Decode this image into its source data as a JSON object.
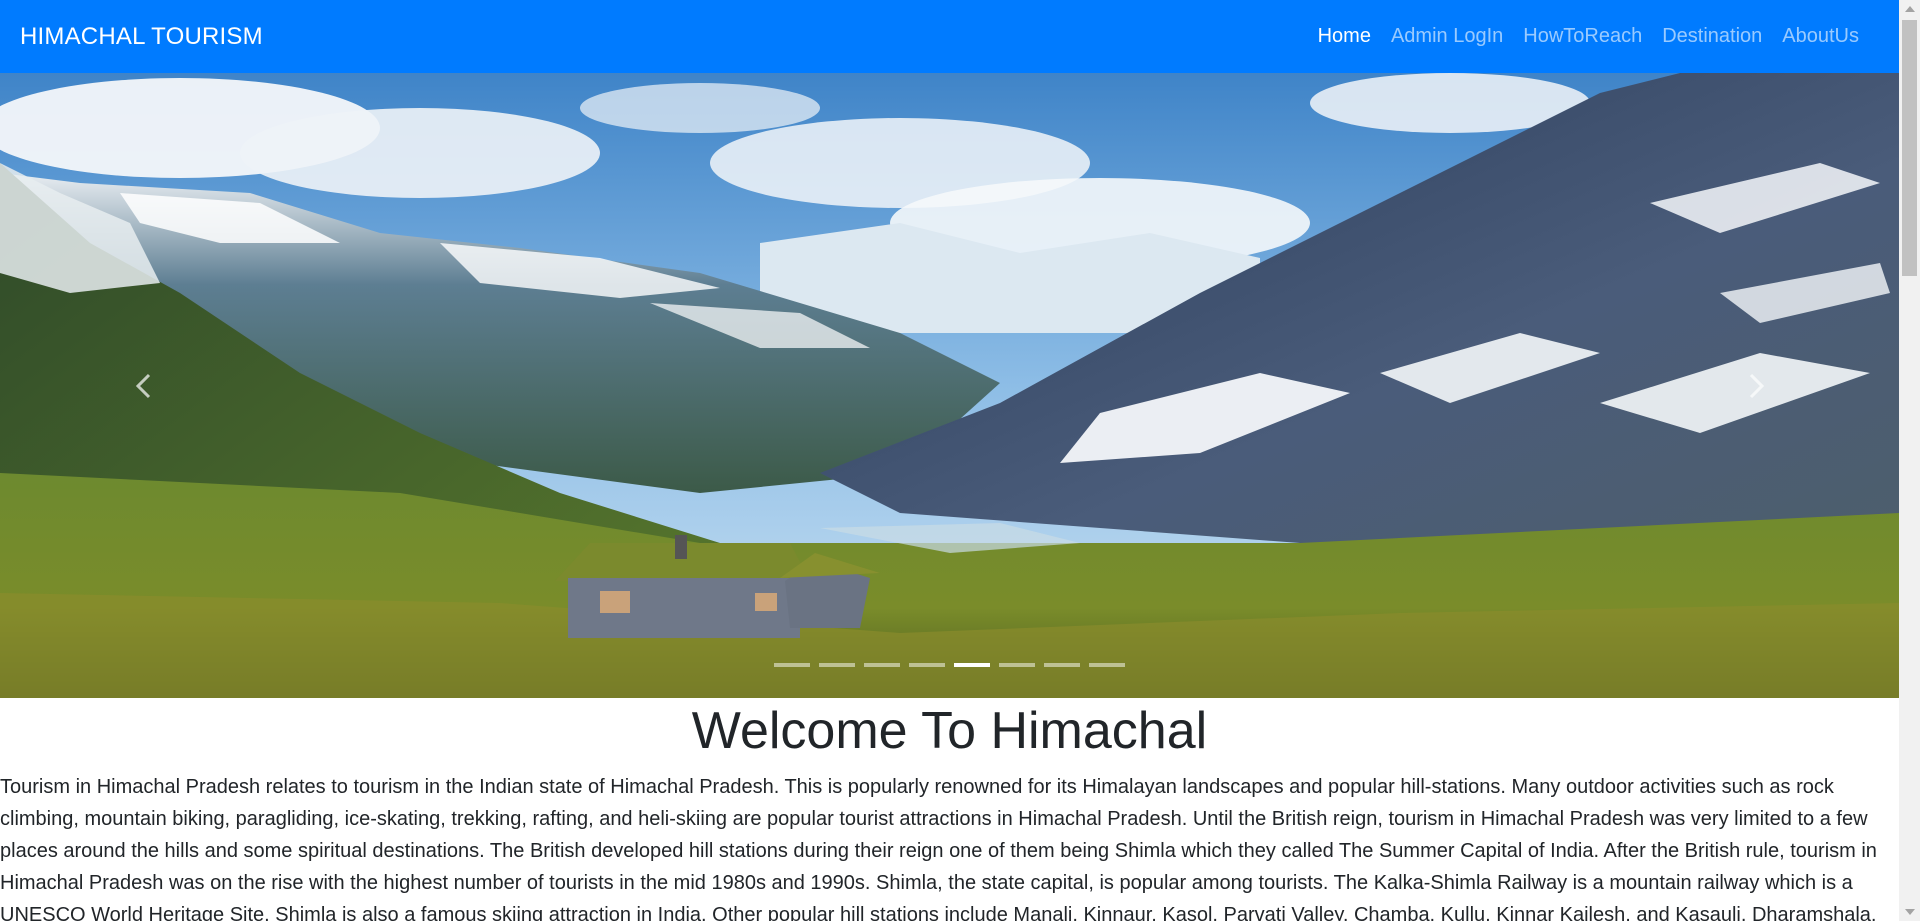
{
  "brand": "HIMACHAL TOURISM",
  "nav": [
    {
      "label": "Home",
      "active": true
    },
    {
      "label": "Admin LogIn",
      "active": false
    },
    {
      "label": "HowToReach",
      "active": false
    },
    {
      "label": "Destination",
      "active": false
    },
    {
      "label": "AboutUs",
      "active": false
    }
  ],
  "carousel": {
    "prev_icon": "chevron-left-icon",
    "next_icon": "chevron-right-icon",
    "slide_count": 8,
    "active_slide": 5
  },
  "welcome_title": "Welcome To Himachal",
  "description": "Tourism in Himachal Pradesh relates to tourism in the Indian state of Himachal Pradesh. This is popularly renowned for its Himalayan landscapes and popular hill-stations. Many outdoor activities such as rock climbing, mountain biking, paragliding, ice-skating, trekking, rafting, and heli-skiing are popular tourist attractions in Himachal Pradesh. Until the British reign, tourism in Himachal Pradesh was very limited to a few places around the hills and some spiritual destinations. The British developed hill stations during their reign one of them being Shimla which they called The Summer Capital of India. After the British rule, tourism in Himachal Pradesh was on the rise with the highest number of tourists in the mid 1980s and 1990s. Shimla, the state capital, is popular among tourists. The Kalka-Shimla Railway is a mountain railway which is a UNESCO World Heritage Site. Shimla is also a famous skiing attraction in India. Other popular hill stations include Manali, Kinnaur, Kasol, Parvati Valley, Chamba, Kullu, Kinnar Kailesh, and Kasauli. Dharamshala,",
  "colors": {
    "navbar": "#007bff",
    "text": "#212529"
  }
}
